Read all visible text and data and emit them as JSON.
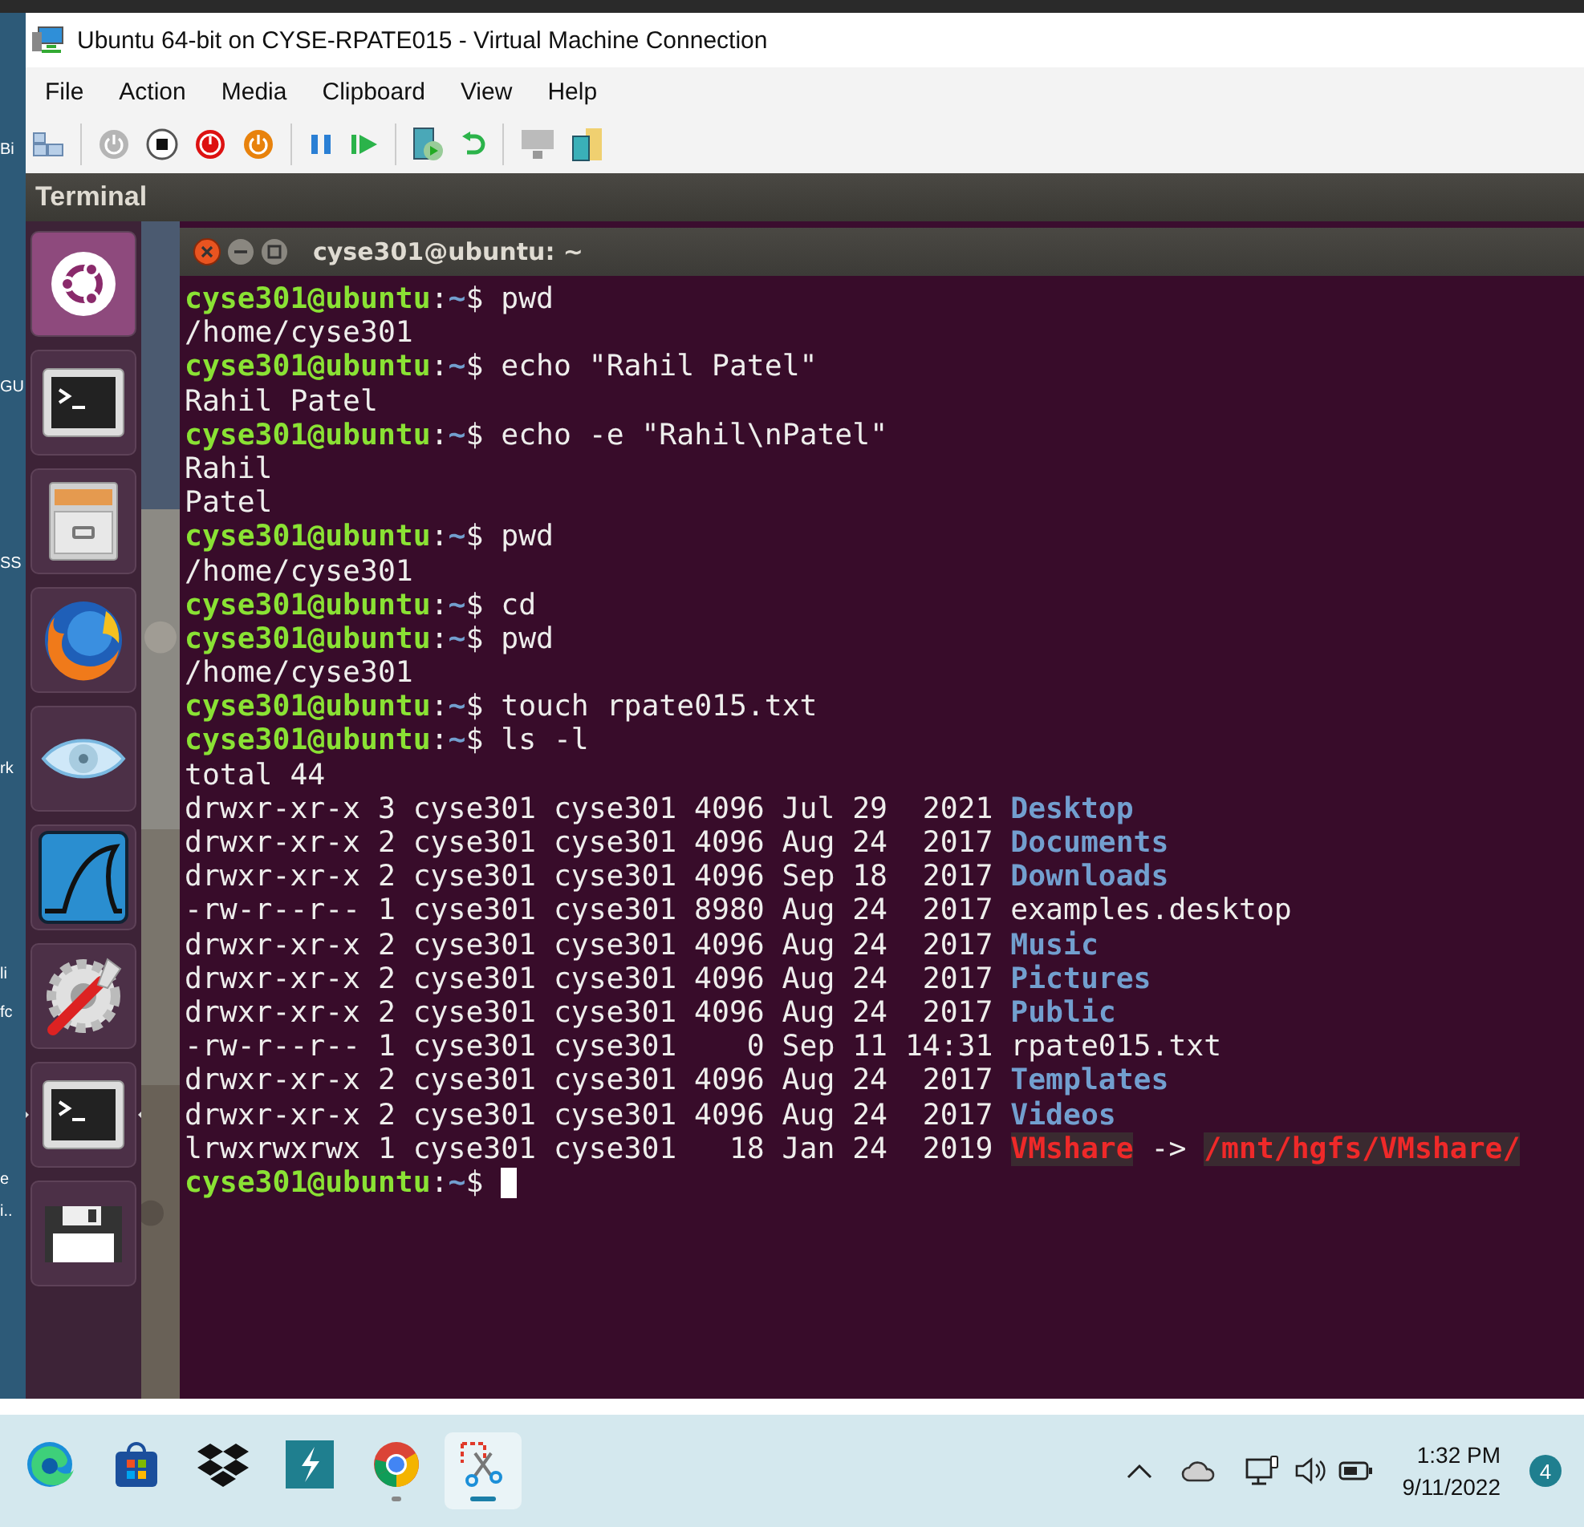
{
  "desktop_fragments": [
    "Bi",
    "GU",
    "SS",
    "rk",
    "li",
    "fc",
    "e",
    "i.."
  ],
  "window": {
    "title": "Ubuntu 64-bit on CYSE-RPATE015 - Virtual Machine Connection",
    "menu": [
      "File",
      "Action",
      "Media",
      "Clipboard",
      "View",
      "Help"
    ]
  },
  "ubuntu": {
    "panel_title": "Terminal",
    "launcher": [
      {
        "kind": "ubuntu",
        "running": false
      },
      {
        "kind": "terminal",
        "running": false
      },
      {
        "kind": "files",
        "running": false
      },
      {
        "kind": "firefox",
        "running": false
      },
      {
        "kind": "eye",
        "running": false
      },
      {
        "kind": "wireshark",
        "running": false
      },
      {
        "kind": "settings",
        "running": false
      },
      {
        "kind": "terminal",
        "running": true
      },
      {
        "kind": "floppy",
        "running": false
      }
    ]
  },
  "terminal": {
    "title": "cyse301@ubuntu: ~",
    "cursor": true,
    "lines": [
      [
        {
          "kind": "user",
          "text": "cyse301@ubuntu"
        },
        {
          "kind": "plain",
          "text": ":"
        },
        {
          "kind": "path",
          "text": "~"
        },
        {
          "kind": "plain",
          "text": "$ pwd"
        }
      ],
      [
        {
          "kind": "plain",
          "text": "/home/cyse301"
        }
      ],
      [
        {
          "kind": "user",
          "text": "cyse301@ubuntu"
        },
        {
          "kind": "plain",
          "text": ":"
        },
        {
          "kind": "path",
          "text": "~"
        },
        {
          "kind": "plain",
          "text": "$ echo \"Rahil Patel\""
        }
      ],
      [
        {
          "kind": "plain",
          "text": "Rahil Patel"
        }
      ],
      [
        {
          "kind": "user",
          "text": "cyse301@ubuntu"
        },
        {
          "kind": "plain",
          "text": ":"
        },
        {
          "kind": "path",
          "text": "~"
        },
        {
          "kind": "plain",
          "text": "$ echo -e \"Rahil\\nPatel\""
        }
      ],
      [
        {
          "kind": "plain",
          "text": "Rahil"
        }
      ],
      [
        {
          "kind": "plain",
          "text": "Patel"
        }
      ],
      [
        {
          "kind": "user",
          "text": "cyse301@ubuntu"
        },
        {
          "kind": "plain",
          "text": ":"
        },
        {
          "kind": "path",
          "text": "~"
        },
        {
          "kind": "plain",
          "text": "$ pwd"
        }
      ],
      [
        {
          "kind": "plain",
          "text": "/home/cyse301"
        }
      ],
      [
        {
          "kind": "user",
          "text": "cyse301@ubuntu"
        },
        {
          "kind": "plain",
          "text": ":"
        },
        {
          "kind": "path",
          "text": "~"
        },
        {
          "kind": "plain",
          "text": "$ cd"
        }
      ],
      [
        {
          "kind": "user",
          "text": "cyse301@ubuntu"
        },
        {
          "kind": "plain",
          "text": ":"
        },
        {
          "kind": "path",
          "text": "~"
        },
        {
          "kind": "plain",
          "text": "$ pwd"
        }
      ],
      [
        {
          "kind": "plain",
          "text": "/home/cyse301"
        }
      ],
      [
        {
          "kind": "user",
          "text": "cyse301@ubuntu"
        },
        {
          "kind": "plain",
          "text": ":"
        },
        {
          "kind": "path",
          "text": "~"
        },
        {
          "kind": "plain",
          "text": "$ touch rpate015.txt"
        }
      ],
      [
        {
          "kind": "user",
          "text": "cyse301@ubuntu"
        },
        {
          "kind": "plain",
          "text": ":"
        },
        {
          "kind": "path",
          "text": "~"
        },
        {
          "kind": "plain",
          "text": "$ ls -l"
        }
      ],
      [
        {
          "kind": "plain",
          "text": "total 44"
        }
      ],
      [
        {
          "kind": "plain",
          "text": "drwxr-xr-x 3 cyse301 cyse301 4096 Jul 29  2021 "
        },
        {
          "kind": "dir",
          "text": "Desktop"
        }
      ],
      [
        {
          "kind": "plain",
          "text": "drwxr-xr-x 2 cyse301 cyse301 4096 Aug 24  2017 "
        },
        {
          "kind": "dir",
          "text": "Documents"
        }
      ],
      [
        {
          "kind": "plain",
          "text": "drwxr-xr-x 2 cyse301 cyse301 4096 Sep 18  2017 "
        },
        {
          "kind": "dir",
          "text": "Downloads"
        }
      ],
      [
        {
          "kind": "plain",
          "text": "-rw-r--r-- 1 cyse301 cyse301 8980 Aug 24  2017 examples.desktop"
        }
      ],
      [
        {
          "kind": "plain",
          "text": "drwxr-xr-x 2 cyse301 cyse301 4096 Aug 24  2017 "
        },
        {
          "kind": "dir",
          "text": "Music"
        }
      ],
      [
        {
          "kind": "plain",
          "text": "drwxr-xr-x 2 cyse301 cyse301 4096 Aug 24  2017 "
        },
        {
          "kind": "dir",
          "text": "Pictures"
        }
      ],
      [
        {
          "kind": "plain",
          "text": "drwxr-xr-x 2 cyse301 cyse301 4096 Aug 24  2017 "
        },
        {
          "kind": "dir",
          "text": "Public"
        }
      ],
      [
        {
          "kind": "plain",
          "text": "-rw-r--r-- 1 cyse301 cyse301    0 Sep 11 14:31 rpate015.txt"
        }
      ],
      [
        {
          "kind": "plain",
          "text": "drwxr-xr-x 2 cyse301 cyse301 4096 Aug 24  2017 "
        },
        {
          "kind": "dir",
          "text": "Templates"
        }
      ],
      [
        {
          "kind": "plain",
          "text": "drwxr-xr-x 2 cyse301 cyse301 4096 Aug 24  2017 "
        },
        {
          "kind": "dir",
          "text": "Videos"
        }
      ],
      [
        {
          "kind": "plain",
          "text": "lrwxrwxrwx 1 cyse301 cyse301   18 Jan 24  2019 "
        },
        {
          "kind": "link",
          "text": "VMshare"
        },
        {
          "kind": "plain",
          "text": " -> "
        },
        {
          "kind": "link",
          "text": "/mnt/hgfs/VMshare/"
        }
      ],
      [
        {
          "kind": "user",
          "text": "cyse301@ubuntu"
        },
        {
          "kind": "plain",
          "text": ":"
        },
        {
          "kind": "path",
          "text": "~"
        },
        {
          "kind": "plain",
          "text": "$ "
        }
      ]
    ]
  },
  "taskbar": {
    "apps": [
      {
        "kind": "edge",
        "running": false,
        "selected": false
      },
      {
        "kind": "store",
        "running": false,
        "selected": false
      },
      {
        "kind": "dropbox",
        "running": false,
        "selected": false
      },
      {
        "kind": "sapp",
        "running": false,
        "selected": false
      },
      {
        "kind": "chrome",
        "running": true,
        "selected": false
      },
      {
        "kind": "snip",
        "running": true,
        "selected": true
      }
    ],
    "time": "1:32 PM",
    "date": "9/11/2022",
    "notifications": "4"
  }
}
